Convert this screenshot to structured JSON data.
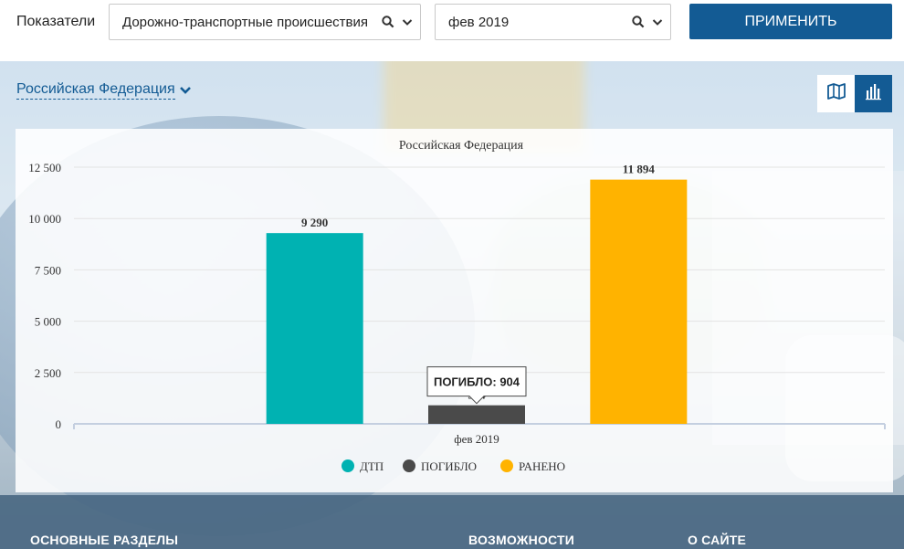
{
  "filters": {
    "label": "Показатели",
    "indicator_value": "Дорожно-транспортные происшествия",
    "period_value": "фев 2019",
    "apply_label": "ПРИМЕНИТЬ"
  },
  "region": {
    "label": "Российская Федерация"
  },
  "icons": {
    "search": "search-icon",
    "dropdown": "chevron-down-icon",
    "map": "map-icon",
    "bar_chart": "bar-chart-icon"
  },
  "tooltip": {
    "label": "ПОГИБЛО: 904"
  },
  "footer": {
    "sections": [
      "ОСНОВНЫЕ РАЗДЕЛЫ",
      "ВОЗМОЖНОСТИ",
      "О САЙТЕ"
    ]
  },
  "chart_data": {
    "type": "bar",
    "title": "Российская Федерация",
    "categories": [
      "фев 2019"
    ],
    "series": [
      {
        "name": "ДТП",
        "values": [
          9290
        ],
        "label": "9 290",
        "color": "#00b2b2"
      },
      {
        "name": "ПОГИБЛО",
        "values": [
          904
        ],
        "label": "904",
        "color": "#4a4a4a"
      },
      {
        "name": "РАНЕНО",
        "values": [
          11894
        ],
        "label": "11 894",
        "color": "#ffb300"
      }
    ],
    "ylim": [
      0,
      12500
    ],
    "yticks": [
      0,
      2500,
      5000,
      7500,
      10000,
      12500
    ],
    "ytick_labels": [
      "0",
      "2 500",
      "5 000",
      "7 500",
      "10 000",
      "12 500"
    ],
    "grid": true,
    "legend": "bottom-center",
    "accent": "#135b94"
  }
}
